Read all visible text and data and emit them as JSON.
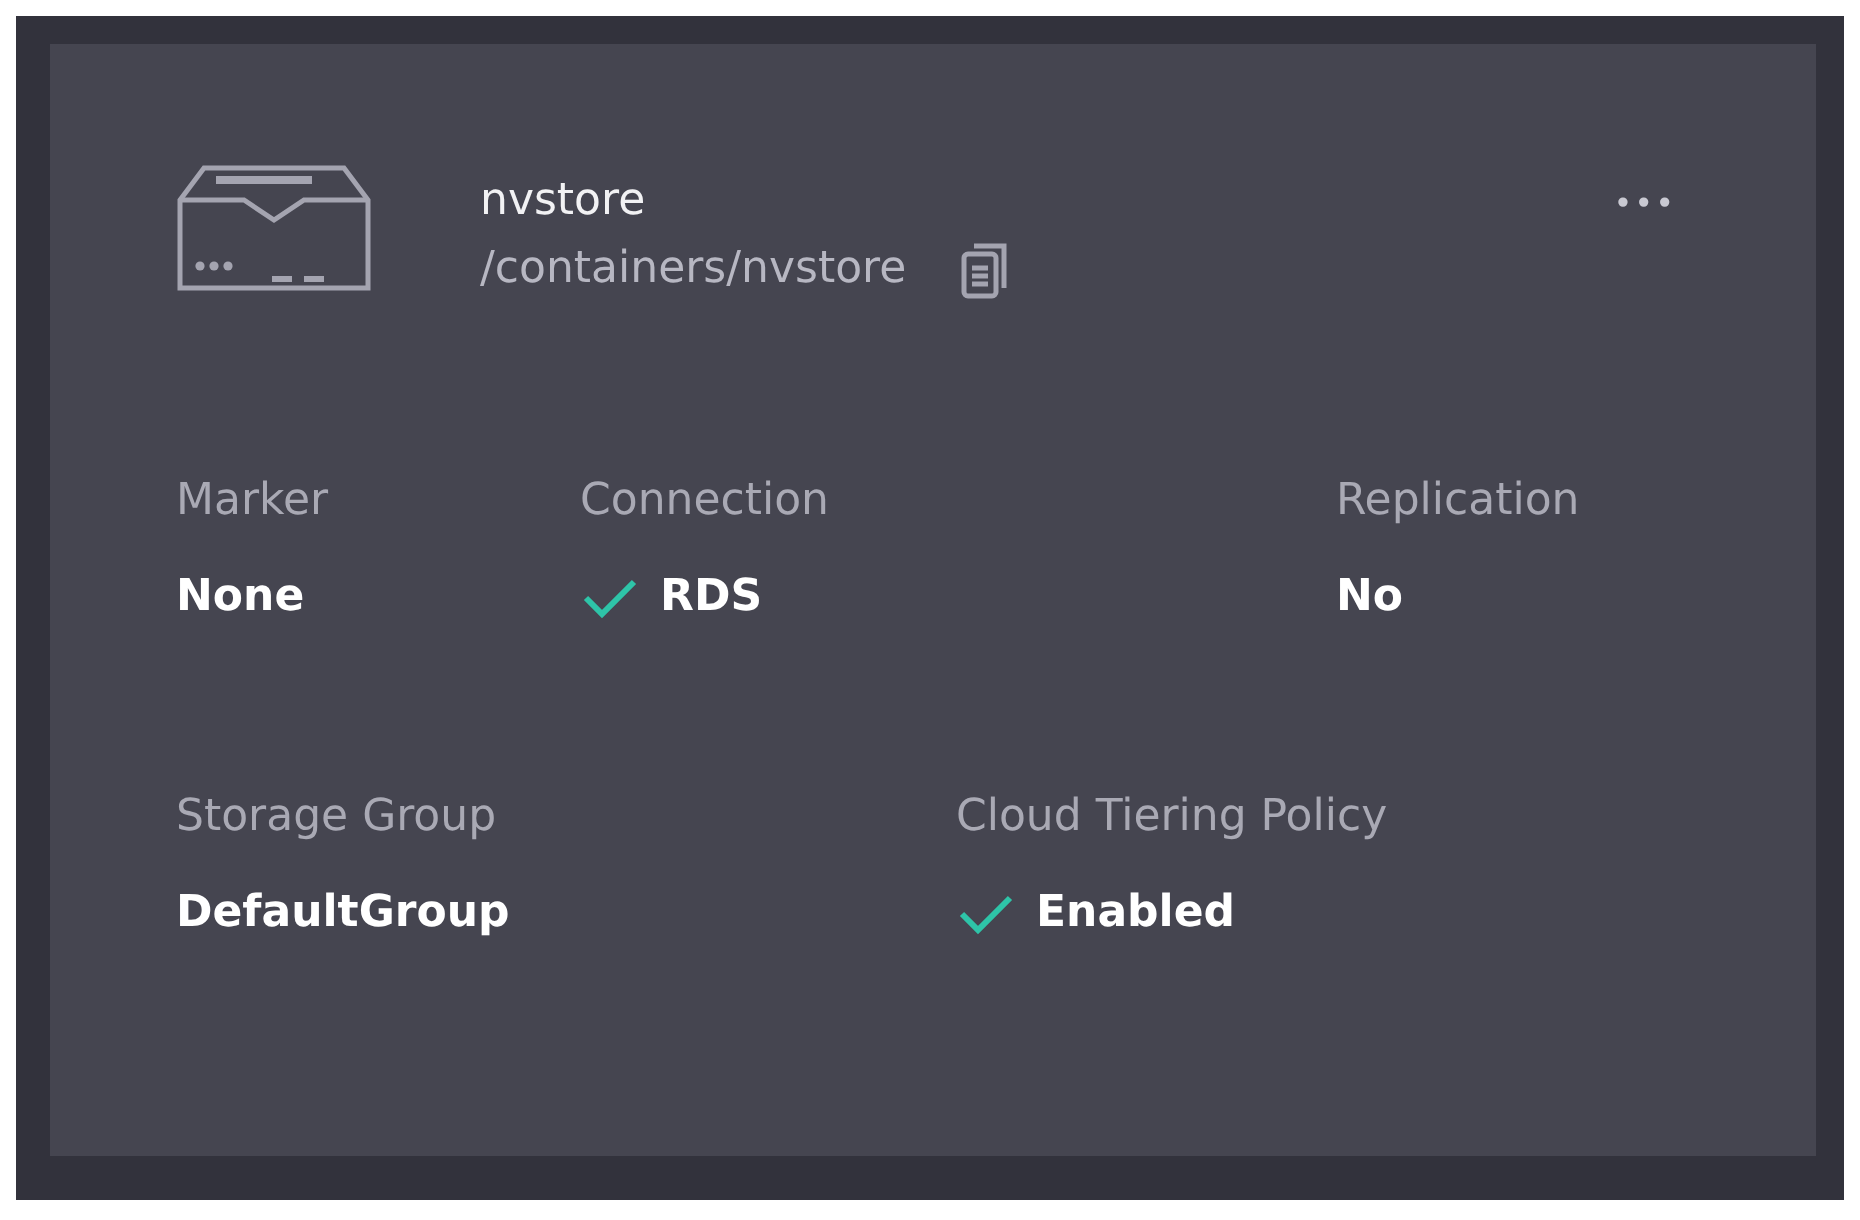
{
  "container": {
    "name": "nvstore",
    "path": "/containers/nvstore",
    "menu": "•••"
  },
  "field_rows": [
    [
      {
        "label": "Marker",
        "value": "None",
        "checked": false
      },
      {
        "label": "Connection",
        "value": "RDS",
        "checked": true
      },
      {
        "label": "Replication",
        "value": "No",
        "checked": false
      }
    ],
    [
      {
        "label": "Storage Group",
        "value": "DefaultGroup",
        "checked": false
      },
      {
        "label": "Cloud Tiering Policy",
        "value": "Enabled",
        "checked": true
      }
    ]
  ]
}
